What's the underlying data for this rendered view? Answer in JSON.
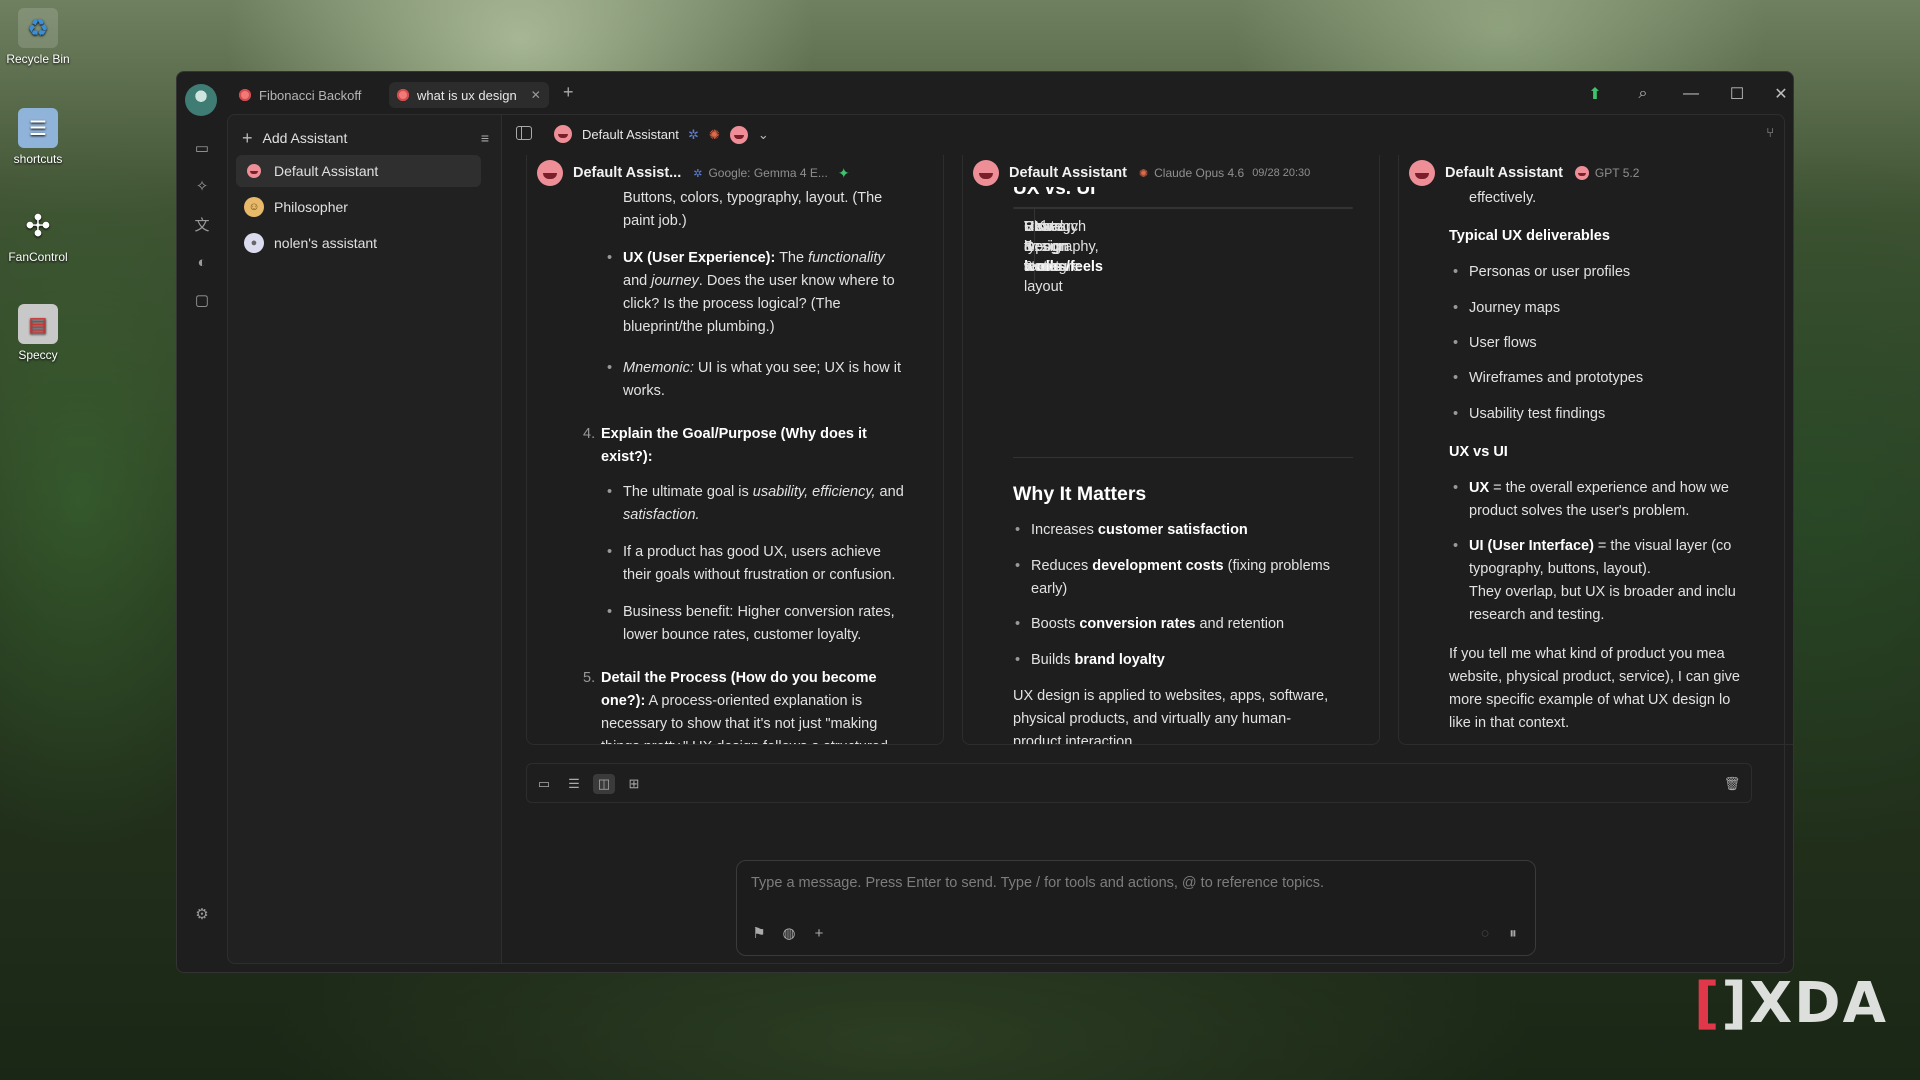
{
  "desktop": {
    "icons": [
      {
        "label": "Recycle Bin",
        "icon": "recycle-bin-icon"
      },
      {
        "label": "shortcuts",
        "icon": "folder-icon"
      },
      {
        "label": "FanControl",
        "icon": "fan-icon"
      },
      {
        "label": "Speccy",
        "icon": "speccy-icon"
      }
    ],
    "watermark": "XDA"
  },
  "titlebar": {
    "tabs": [
      {
        "label": "Fibonacci Backoff",
        "active": false
      },
      {
        "label": "what is ux design",
        "active": true
      }
    ],
    "new_tab": "+"
  },
  "assistants": {
    "add_label": "Add Assistant",
    "items": [
      {
        "label": "Default Assistant",
        "active": true
      },
      {
        "label": "Philosopher",
        "active": false
      },
      {
        "label": "nolen's assistant",
        "active": false
      }
    ]
  },
  "topbar": {
    "title": "Default Assistant"
  },
  "columns": [
    {
      "name": "Default Assist...",
      "model": "Google: Gemma 4 E...",
      "lines": {
        "l1": "Buttons, colors, typography, layout. (The",
        "l2": "paint job.)",
        "b2_a": "UX (User Experience):",
        "b2_b": " The ",
        "b2_c": "functionality",
        "b2_d": "and ",
        "b2_e": "journey",
        "b2_f": ". Does the user know where to",
        "b2_g": "click? Is the process logical? (The",
        "b2_h": "blueprint/the plumbing.)",
        "b3_a": "Mnemonic:",
        "b3_b": " UI is what you see; UX is how it",
        "b3_c": "works.",
        "n4": "4.",
        "h4_a": "Explain the Goal/Purpose (Why does it",
        "h4_b": "exist?):",
        "g1_a": "The ultimate goal is ",
        "g1_b": "usability, efficiency,",
        "g1_c": " and",
        "g1_d": "satisfaction.",
        "g2_a": "If a product has good UX, users achieve",
        "g2_b": "their goals without frustration or confusion.",
        "g3_a": "Business benefit: Higher conversion rates,",
        "g3_b": "lower bounce rates, customer loyalty.",
        "n5": "5.",
        "h5_a": "Detail the Process (How do you become",
        "h5_b": "one?):",
        "h5_c": " A process-oriented explanation is",
        "h5_d": "necessary to show that it's not just \"making",
        "h5_e": "things pretty.\" UX design follows a structured"
      }
    },
    {
      "name": "Default Assistant",
      "model": "Claude Opus 4.6",
      "time": "09/28 20:30",
      "heading_partial": "UX vs. UI",
      "table": [
        [
          "UX Design",
          "UI Design"
        ],
        [
          "How it ",
          "works/feels",
          "How it ",
          "looks"
        ],
        [
          "Strategy &",
          "structure",
          "Visual design & layout"
        ],
        [
          "Research & testing",
          "Colors, typography,",
          "icons"
        ]
      ],
      "why_heading": "Why It Matters",
      "bullets": {
        "w1_a": "Increases ",
        "w1_b": "customer satisfaction",
        "w2_a": "Reduces ",
        "w2_b": "development costs",
        "w2_c": " (fixing problems",
        "w2_d": "early)",
        "w3_a": "Boosts ",
        "w3_b": "conversion rates",
        "w3_c": " and retention",
        "w4_a": "Builds ",
        "w4_b": "brand loyalty"
      },
      "para": [
        "UX design is applied to websites, apps, software,",
        "physical products, and virtually any human-",
        "product interaction."
      ]
    },
    {
      "name": "Default Assistant",
      "model": "GPT 5.2",
      "l_top": "effectively.",
      "deliv_heading": "Typical UX deliverables",
      "deliv": [
        "Personas or user profiles",
        "Journey maps",
        "User flows",
        "Wireframes and prototypes",
        "Usability test findings"
      ],
      "uxvsui_heading": "UX vs UI",
      "u1_a": "UX",
      "u1_b": " = the overall experience and how we",
      "u1_c": "product solves the user's problem.",
      "u2_a": "UI (User Interface)",
      "u2_b": " = the visual layer (co",
      "u2_c": "typography, buttons, layout).",
      "u2_d": "They overlap, but UX is broader and inclu",
      "u2_e": "research and testing.",
      "final": [
        "If you tell me what kind of product you mea",
        "website, physical product, service), I can give",
        "more specific example of what UX design lo",
        "like in that context."
      ]
    }
  ],
  "composer": {
    "placeholder": "Type a message. Press Enter to send. Type / for tools and actions, @ to reference topics."
  }
}
